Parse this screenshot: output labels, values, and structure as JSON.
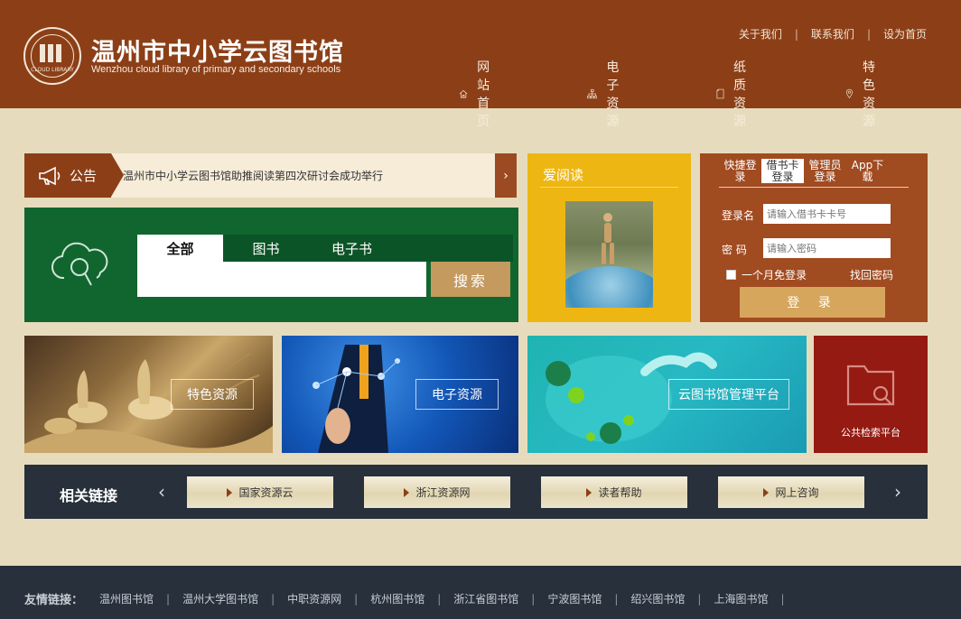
{
  "header": {
    "title": "温州市中小学云图书馆",
    "subtitle": "Wenzhou cloud library of primary and secondary schools",
    "logo_text": "CLOUD LIBRARY",
    "top_links": [
      "关于我们",
      "联系我们",
      "设为首页"
    ],
    "nav": [
      {
        "label": "网站首页",
        "icon": "home-icon"
      },
      {
        "label": "电子资源",
        "icon": "network-icon"
      },
      {
        "label": "纸质资源",
        "icon": "document-icon"
      },
      {
        "label": "特色资源",
        "icon": "location-pin-icon"
      }
    ]
  },
  "notice": {
    "label": "公告",
    "text": "温州市中小学云图书馆助推阅读第四次研讨会成功举行",
    "arrow": "›"
  },
  "search": {
    "tabs": [
      "全部",
      "图书",
      "电子书"
    ],
    "active_tab": 0,
    "button": "搜索",
    "placeholder": ""
  },
  "love_read": {
    "title": "爱阅读"
  },
  "login": {
    "tabs": [
      "快捷登录",
      "借书卡登录",
      "管理员登录",
      "App下载"
    ],
    "active_tab": 1,
    "username_label": "登录名",
    "username_placeholder": "请输入借书卡卡号",
    "password_label": "密 码",
    "password_placeholder": "请输入密码",
    "remember": "一个月免登录",
    "find_password": "找回密码",
    "submit": "登 录"
  },
  "tiles": {
    "special": "特色资源",
    "electronic": "电子资源",
    "cloud": "云图书馆管理平台",
    "public": "公共检索平台"
  },
  "related_links": {
    "title": "相关链接",
    "prev": "‹",
    "next": "›",
    "items": [
      "国家资源云",
      "浙江资源网",
      "读者帮助",
      "网上咨询"
    ]
  },
  "footer": {
    "title": "友情链接：",
    "links": [
      "温州图书馆",
      "温州大学图书馆",
      "中职资源网",
      "杭州图书馆",
      "浙江省图书馆",
      "宁波图书馆",
      "绍兴图书馆",
      "上海图书馆"
    ],
    "separator": "|"
  },
  "colors": {
    "brand": "#8c3f17",
    "page_bg": "#e6dcbd",
    "search_green": "#11662f",
    "reading_yellow": "#eeb612",
    "login_brown": "#a14b21",
    "dark_bar": "#27303b",
    "public_red": "#941a12"
  }
}
